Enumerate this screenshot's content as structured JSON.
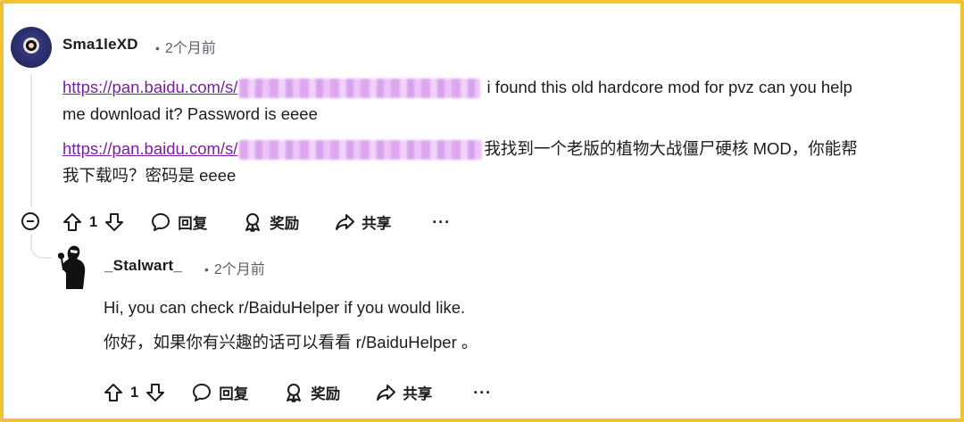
{
  "comment": {
    "username": "Sma1leXD",
    "time": "2个月前",
    "link1_text": "https://pan.baidu.com/s/",
    "text1_line1": " i found this old hardcore mod for pvz can you help",
    "text1_line2": "me download it? Password is eeee",
    "link2_text": "https://pan.baidu.com/s/",
    "text2_line1": "我找到一个老版的植物大战僵尸硬核 MOD，你能帮",
    "text2_line2": "我下载吗？密码是 eeee",
    "votes": "1",
    "actions": {
      "reply": "回复",
      "award": "奖励",
      "share": "共享",
      "more": "···"
    }
  },
  "reply": {
    "username": "_Stalwart_",
    "time": "2个月前",
    "text_en": "Hi, you can check r/BaiduHelper if you would like.",
    "text_zh": "你好，如果你有兴趣的话可以看看 r/BaiduHelper 。",
    "votes": "1",
    "actions": {
      "reply": "回复",
      "award": "奖励",
      "share": "共享",
      "more": "···"
    }
  },
  "colors": {
    "frame": "#f2c230",
    "link": "#7b1fa2",
    "text": "#1c1c1c",
    "meta": "#5c6168"
  },
  "icons": [
    "upvote-icon",
    "downvote-icon",
    "comment-icon",
    "award-icon",
    "share-icon",
    "more-icon",
    "collapse-icon"
  ]
}
